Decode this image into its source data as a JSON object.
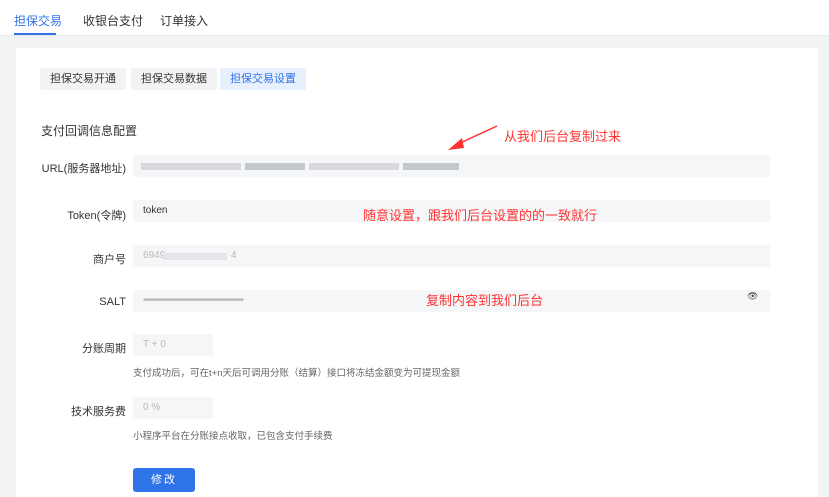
{
  "topnav": {
    "tabs": [
      {
        "label": "担保交易",
        "active": true
      },
      {
        "label": "收银台支付",
        "active": false
      },
      {
        "label": "订单接入",
        "active": false
      }
    ]
  },
  "subtabs": [
    {
      "label": "担保交易开通",
      "active": false
    },
    {
      "label": "担保交易数据",
      "active": false
    },
    {
      "label": "担保交易设置",
      "active": true
    }
  ],
  "section_title": "支付回调信息配置",
  "form": {
    "url": {
      "label": "URL(服务器地址)",
      "value": ""
    },
    "token": {
      "label": "Token(令牌)",
      "value": "token"
    },
    "merchant": {
      "label": "商户号",
      "value": "6949",
      "value_tail": "4"
    },
    "salt": {
      "label": "SALT",
      "value": "••••••••••••••••••••••••••••••••••••••••"
    },
    "period": {
      "label": "分账周期",
      "placeholder": "T + 0",
      "hint": "支付成功后，可在t+n天后可调用分账（结算）接口将冻结金额变为可提现金额"
    },
    "fee": {
      "label": "技术服务费",
      "placeholder": "0 %",
      "hint": "小程序平台在分账接点收取，已包含支付手续费"
    },
    "submit_label": "修改"
  },
  "annotations": {
    "url": "从我们后台复制过来",
    "token": "随意设置，跟我们后台设置的的一致就行",
    "salt": "复制内容到我们后台"
  },
  "colors": {
    "accent": "#2f73e8",
    "annotation": "#ff3333"
  }
}
